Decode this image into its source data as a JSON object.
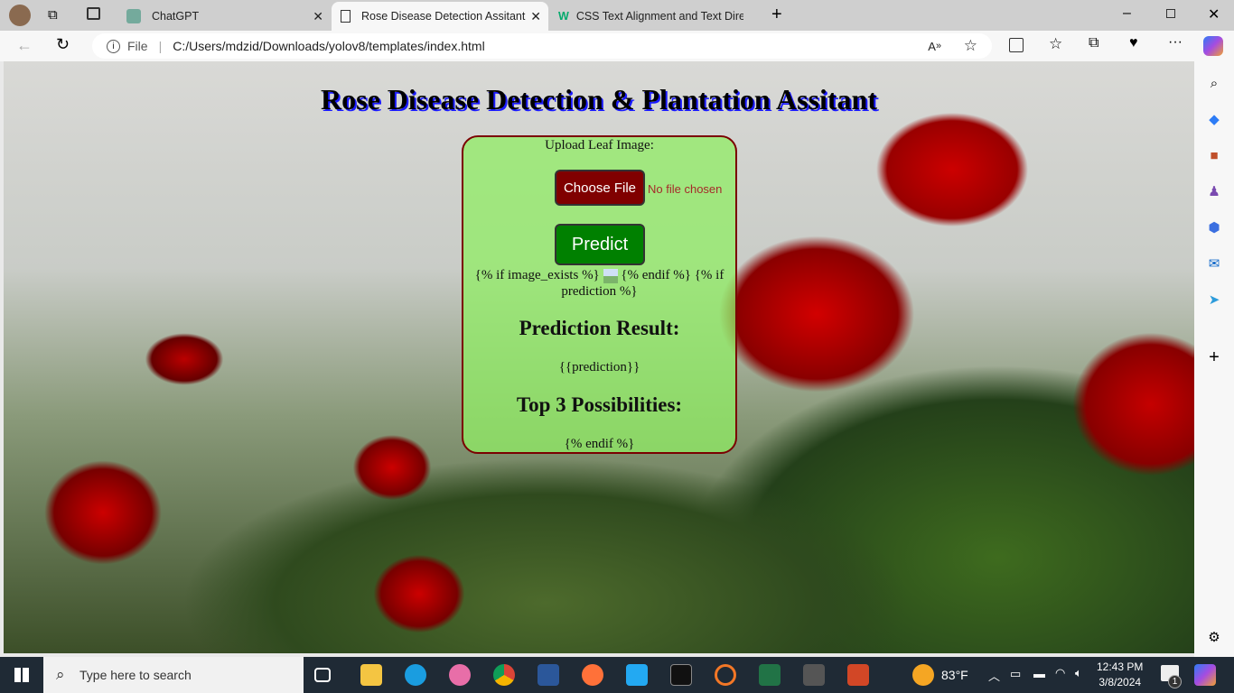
{
  "browser": {
    "tabs": [
      {
        "label": "ChatGPT",
        "active": false
      },
      {
        "label": "Rose Disease Detection Assitant",
        "active": true
      },
      {
        "label": "CSS Text Alignment and Text Dire",
        "active": false
      }
    ],
    "url_scheme": "File",
    "url": "C:/Users/mdzid/Downloads/yolov8/templates/index.html"
  },
  "page": {
    "title": "Rose Disease Detection & Plantation Assitant",
    "upload_label": "Upload Leaf Image:",
    "choose_file": "Choose File",
    "no_file": "No file chosen",
    "predict": "Predict",
    "tpl_line1a": "{% if image_exists %}",
    "tpl_line1b": "{% endif %}  {% if prediction %}",
    "result_heading": "Prediction Result:",
    "prediction": "{{prediction}}",
    "top3_heading": "Top 3 Possibilities:",
    "endif": "{% endif %}"
  },
  "taskbar": {
    "search_placeholder": "Type here to search",
    "weather": "83°F",
    "time": "12:43 PM",
    "date": "3/8/2024",
    "notifications": "1"
  }
}
